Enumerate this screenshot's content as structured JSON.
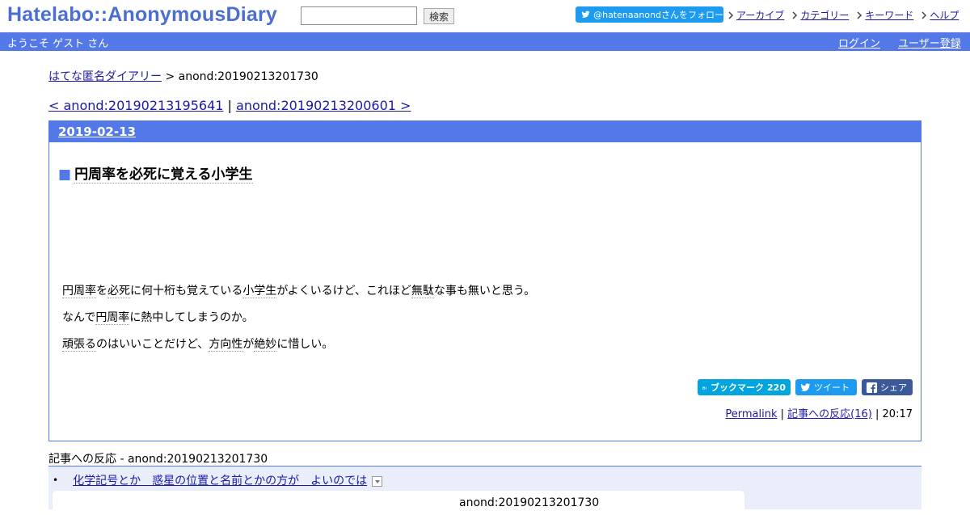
{
  "header": {
    "logo": "Hatelabo::AnonymousDiary",
    "search_value": "",
    "search_button": "検索",
    "follow_button": "@hatenaanondさんをフォロー",
    "nav": [
      "アーカイブ",
      "カテゴリー",
      "キーワード",
      "ヘルプ"
    ]
  },
  "bar": {
    "welcome": "ようこそ ゲスト さん",
    "login": "ログイン",
    "register": "ユーザー登録"
  },
  "breadcrumb": {
    "home": "はてな匿名ダイアリー",
    "separator": ">",
    "current": "anond:20190213201730"
  },
  "pager": {
    "prev": "< anond:20190213195641",
    "divider": "|",
    "next": "anond:20190213200601 >"
  },
  "day": {
    "date": "2019-02-13",
    "entry": {
      "title_mark": "■",
      "title": "円周率を必死に覚える小学生",
      "paragraphs": [
        [
          "円周率",
          "を",
          "必死",
          "に何十桁も覚えている",
          "小学生",
          "がよくいるけど、これほど",
          "無駄",
          "な事も無いと思う。"
        ],
        [
          "なんで",
          "円周率",
          "に熱中してしまうのか。"
        ],
        [
          "頑張る",
          "のはいいことだけど、",
          "方向性",
          "が",
          "絶妙",
          "に惜しい。"
        ]
      ],
      "share": {
        "bookmark_label": "ブックマーク",
        "bookmark_count": "220",
        "tweet": "ツイート",
        "facebook": "シェア"
      },
      "footer": {
        "permalink": "Permalink",
        "sep": "|",
        "reactions_link": "記事への反応(16)",
        "time": "20:17"
      }
    }
  },
  "reactions": {
    "title_kw": "記事への反応",
    "title_rest": " - anond:20190213201730",
    "items": [
      {
        "text": "化学記号とか　惑星の位置と名前とかの方が　よいのでは"
      }
    ],
    "card_text": "anond:20190213201730"
  },
  "colors": {
    "brand_blue": "#5279e7",
    "logo_blue": "#4b6fd1",
    "twitter_blue": "#1d9bf0",
    "hatena_blue": "#00a4de",
    "facebook_blue": "#3b5998",
    "reactions_bg": "#eaeefa"
  },
  "icons": {
    "follow": "twitter-bird-icon",
    "nav": "arrow-right-icon",
    "bookmark": "hatena-b-icon",
    "tweet": "twitter-bird-icon",
    "share": "facebook-f-icon",
    "toggle": "chevron-down-icon"
  }
}
